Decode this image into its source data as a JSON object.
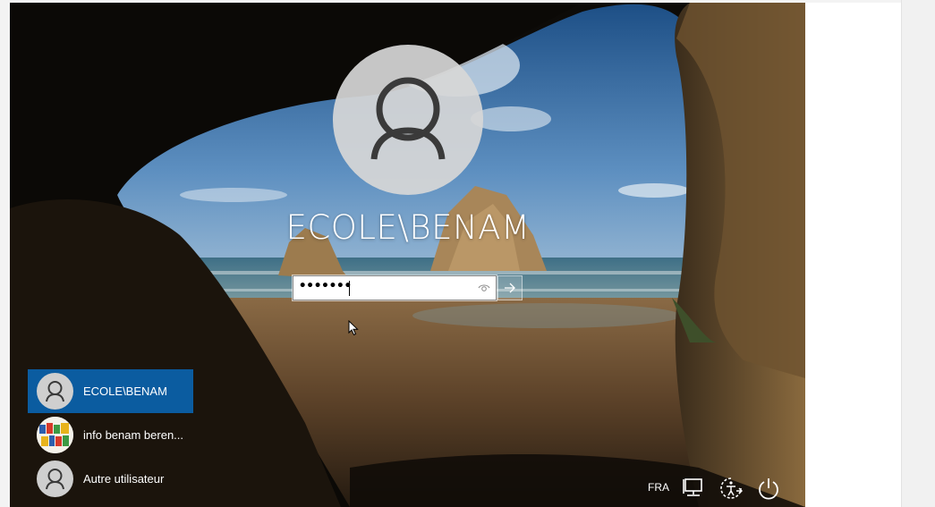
{
  "login": {
    "username": "ECOLE\\BENAM",
    "password_masked": "•••••••"
  },
  "icons": {
    "reveal": "eye-icon",
    "submit": "arrow-right-icon",
    "network": "network-icon",
    "ease_of_access": "ease-of-access-icon",
    "power": "power-icon"
  },
  "users": [
    {
      "label": "ECOLE\\BENAM",
      "selected": true,
      "avatar": "default-user-icon"
    },
    {
      "label": "info benam beren...",
      "selected": false,
      "avatar": "custom-picture"
    },
    {
      "label": "Autre utilisateur",
      "selected": false,
      "avatar": "default-user-icon"
    }
  ],
  "tray": {
    "language": "FRA"
  },
  "colors": {
    "selected_user_bg": "#0b5ca0",
    "text": "#ffffff"
  }
}
